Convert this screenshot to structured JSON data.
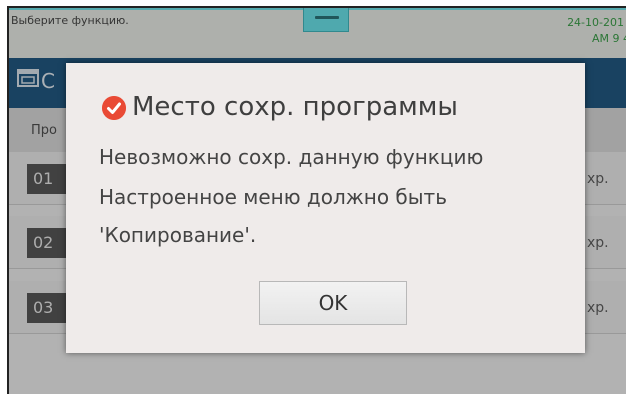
{
  "status_bar": {
    "prompt": "Выберите функцию.",
    "date": "24-10-201",
    "time": "AM 9  4"
  },
  "header": {
    "title": "C",
    "icon": "window-icon"
  },
  "subheader": {
    "label": "Про"
  },
  "programs": [
    {
      "number": "01",
      "name": "",
      "save_label": "хр."
    },
    {
      "number": "02",
      "name": "",
      "save_label": "хр."
    },
    {
      "number": "03",
      "name": "",
      "save_label": "хр."
    }
  ],
  "dialog": {
    "icon": "check-circle-icon",
    "title": "Место сохр. программы",
    "lines": [
      "Невозможно сохр. данную функцию",
      "Настроенное меню должно быть",
      "'Копирование'."
    ],
    "ok_label": "OK"
  },
  "colors": {
    "header_bg": "#124f7c",
    "status_time": "#2d9b3d",
    "dialog_icon": "#e94a35",
    "accent_line": "#69e8ee"
  }
}
